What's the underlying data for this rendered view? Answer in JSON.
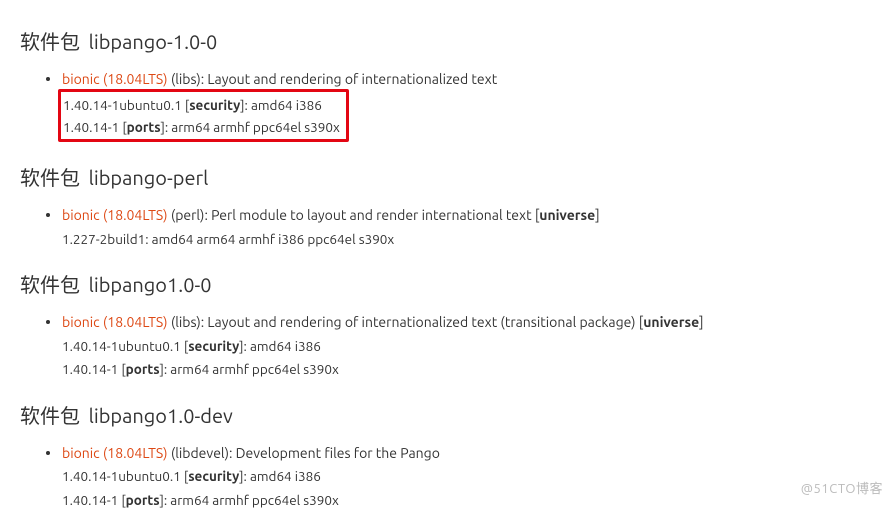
{
  "heading_prefix": "软件包",
  "packages": [
    {
      "name": "libpango-1.0-0",
      "highlight": true,
      "release": {
        "link": "bionic (18.04LTS)",
        "section": "(libs)",
        "desc": "Layout and rendering of internationalized text",
        "tail": ""
      },
      "lines": [
        {
          "version": "1.40.14-1ubuntu0.1",
          "repo": "security",
          "archs": "amd64 i386"
        },
        {
          "version": "1.40.14-1",
          "repo": "ports",
          "archs": "arm64 armhf ppc64el s390x"
        }
      ]
    },
    {
      "name": "libpango-perl",
      "highlight": false,
      "release": {
        "link": "bionic (18.04LTS)",
        "section": "(perl)",
        "desc": "Perl module to layout and render international text",
        "tail": "universe"
      },
      "lines": [
        {
          "version": "1.227-2build1",
          "repo": "",
          "archs": "amd64 arm64 armhf i386 ppc64el s390x"
        }
      ]
    },
    {
      "name": "libpango1.0-0",
      "highlight": false,
      "release": {
        "link": "bionic (18.04LTS)",
        "section": "(libs)",
        "desc": "Layout and rendering of internationalized text (transitional package)",
        "tail": "universe"
      },
      "lines": [
        {
          "version": "1.40.14-1ubuntu0.1",
          "repo": "security",
          "archs": "amd64 i386"
        },
        {
          "version": "1.40.14-1",
          "repo": "ports",
          "archs": "arm64 armhf ppc64el s390x"
        }
      ]
    },
    {
      "name": "libpango1.0-dev",
      "highlight": false,
      "release": {
        "link": "bionic (18.04LTS)",
        "section": "(libdevel)",
        "desc": "Development files for the Pango",
        "tail": ""
      },
      "lines": [
        {
          "version": "1.40.14-1ubuntu0.1",
          "repo": "security",
          "archs": "amd64 i386"
        },
        {
          "version": "1.40.14-1",
          "repo": "ports",
          "archs": "arm64 armhf ppc64el s390x"
        }
      ]
    }
  ],
  "watermark": "@51CTO博客"
}
